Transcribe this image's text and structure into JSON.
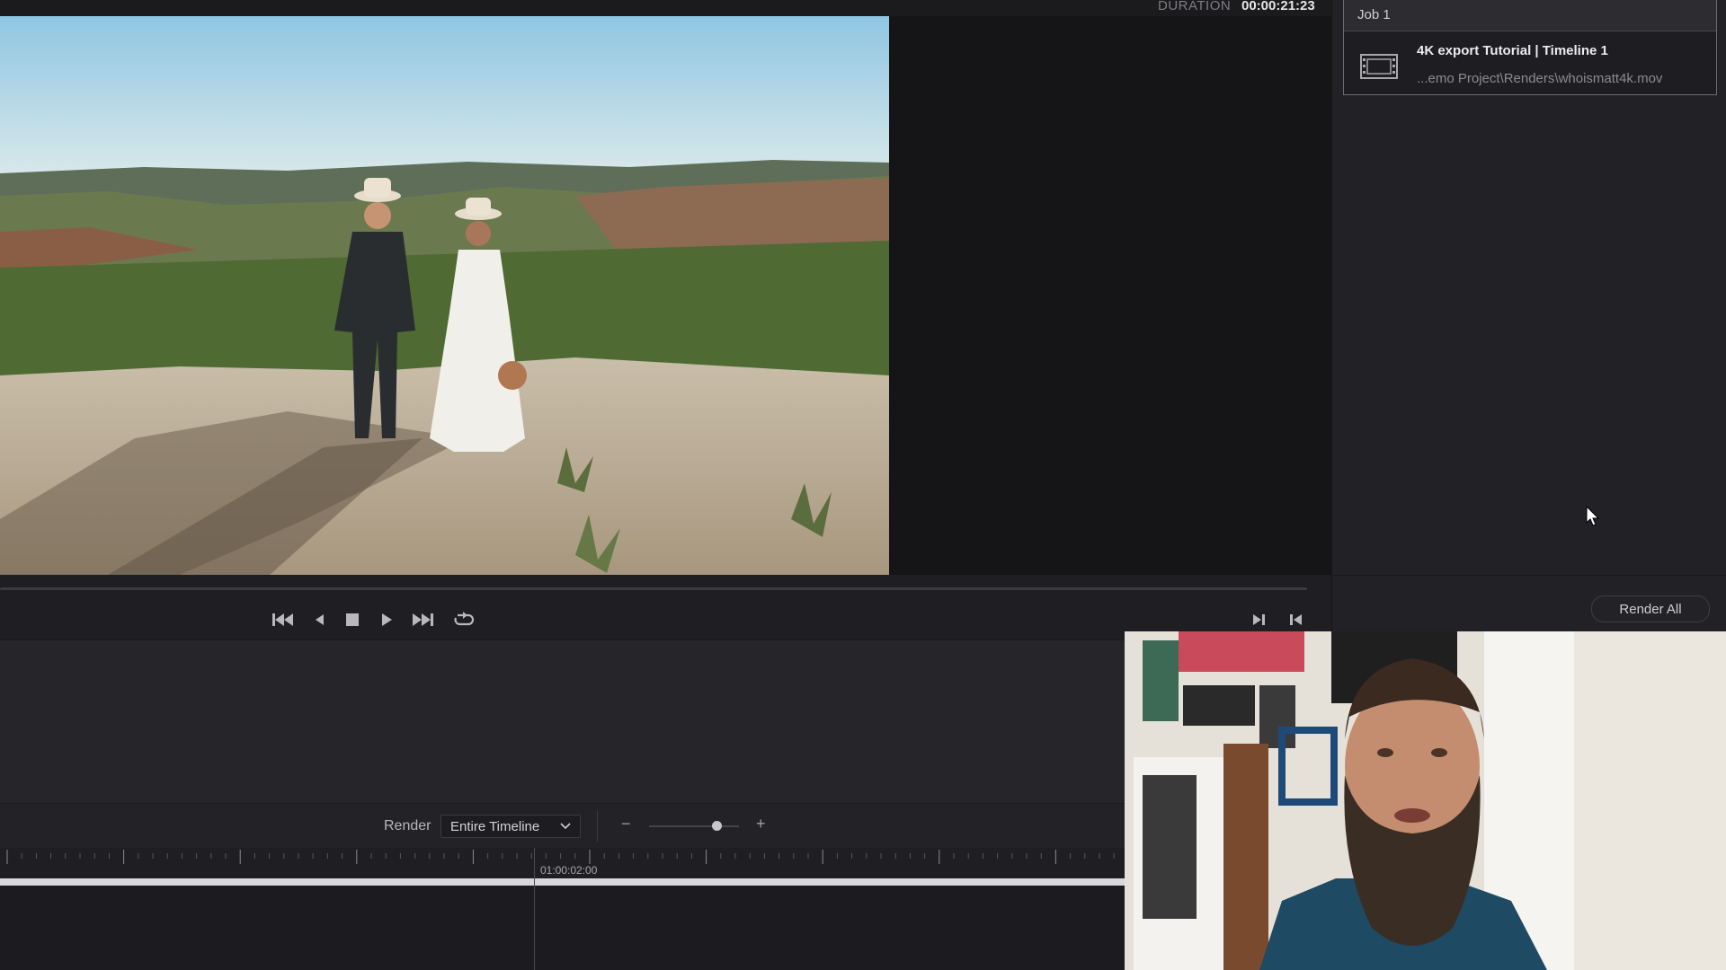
{
  "viewer": {
    "duration_label": "DURATION",
    "duration_value": "00:00:21:23"
  },
  "queue": {
    "job_title": "Job 1",
    "job_name": "4K export Tutorial | Timeline 1",
    "job_path": "...emo Project\\Renders\\whoismatt4k.mov",
    "render_all_label": "Render All"
  },
  "render_bar": {
    "render_label": "Render",
    "range_selected": "Entire Timeline",
    "zoom_level": 0.75
  },
  "timeline": {
    "timecode": "01:00:02:00"
  },
  "icons": {
    "transport": [
      "skip-to-start-icon",
      "step-back-icon",
      "stop-icon",
      "play-icon",
      "skip-to-end-icon",
      "loop-icon"
    ],
    "inout": [
      "mark-in-icon",
      "mark-out-icon"
    ]
  },
  "colors": {
    "panel_bg": "#1f1f23",
    "accent_text": "#e6e6e8",
    "selected_border": "#6a6a70"
  }
}
